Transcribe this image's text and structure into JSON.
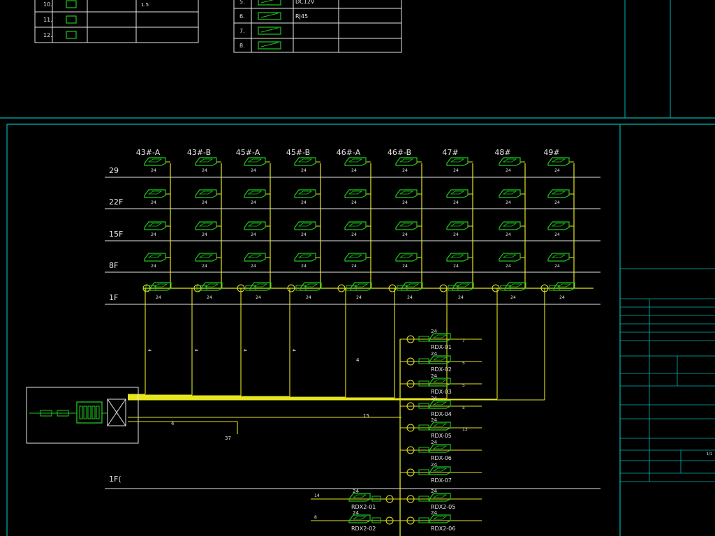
{
  "legend_top": {
    "rows_left": [
      {
        "num": "10.",
        "desc": "",
        "note": "1.5"
      },
      {
        "num": "11.",
        "desc": "",
        "note": ""
      },
      {
        "num": "12.",
        "desc": "",
        "note": ""
      }
    ],
    "rows_right": [
      {
        "num": "5.",
        "label": "DC12V"
      },
      {
        "num": "6.",
        "label": "RJ45"
      },
      {
        "num": "7.",
        "label": ""
      },
      {
        "num": "8.",
        "label": ""
      }
    ]
  },
  "buildings": [
    "43#-A",
    "43#-B",
    "45#-A",
    "45#-B",
    "46#-A",
    "46#-B",
    "47#",
    "48#",
    "49#"
  ],
  "floors": [
    "29",
    "22F",
    "15F",
    "8F",
    "1F"
  ],
  "basement_label": "1F(",
  "switch_label": "24",
  "rdx_left": [
    "RDX2-01",
    "RDX2-02"
  ],
  "rdx_right": [
    "RDX-01",
    "RDX-02",
    "RDX-03",
    "RDX-04",
    "RDX-05",
    "RDX-06",
    "RDX-07",
    "RDX2-05",
    "RDX2-06"
  ],
  "rdx_counts": [
    "7",
    "5",
    "5",
    "5",
    "13",
    "",
    "",
    "",
    ""
  ],
  "rdx_left_counts": [
    "14",
    "8"
  ],
  "cable_labels": [
    "4",
    "4",
    "4",
    "4",
    "4",
    "4",
    "15",
    "4",
    "37"
  ],
  "title_block": {
    "date_label": "",
    "version": "",
    "sheet": "1/1"
  },
  "colors": {
    "frame": "#00b4b4",
    "yellow": "#e6e61e",
    "green": "#1ec81e",
    "white": "#e6e6e6"
  }
}
